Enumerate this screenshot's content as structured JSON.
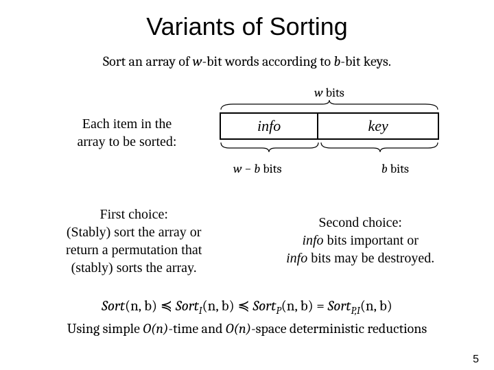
{
  "title": "Variants of Sorting",
  "intro": {
    "prefix": "Sort an array of ",
    "w": "w",
    "mid1": "-bit words according to ",
    "b": "b",
    "suffix": "-bit keys."
  },
  "left_desc_line1": "Each item in the",
  "left_desc_line2": "array to be sorted:",
  "top_brace": {
    "w": "w",
    "bits": " bits"
  },
  "box": {
    "info": "info",
    "key": "key"
  },
  "bottom_left": {
    "w": "w",
    "minus": " − ",
    "b": "b",
    "bits": " bits"
  },
  "bottom_right": {
    "b": "b",
    "bits": " bits"
  },
  "choice1": {
    "l1": "First choice:",
    "l2": "(Stably) sort the array or",
    "l3": "return a permutation that",
    "l4": "(stably) sorts the array."
  },
  "choice2": {
    "l1": "Second choice:",
    "l2a": "info",
    "l2b": " bits important or",
    "l3a": "info",
    "l3b": " bits may be destroyed."
  },
  "formula": {
    "f1": "Sort",
    "a1": "(n, b)",
    "le1": " ≼ ",
    "f2": "Sort",
    "s2": "I",
    "a2": "(n, b)",
    "le2": " ≼ ",
    "f3": "Sort",
    "s3": "P",
    "a3": "(n, b)",
    "eq": " = ",
    "f4": "Sort",
    "s4": "P,I",
    "a4": "(n, b)"
  },
  "footer": {
    "prefix": "Using simple ",
    "on1": "O(n)",
    "mid1": "-time and ",
    "on2": "O(n)",
    "suffix": "-space deterministic reductions"
  },
  "page_number": "5"
}
